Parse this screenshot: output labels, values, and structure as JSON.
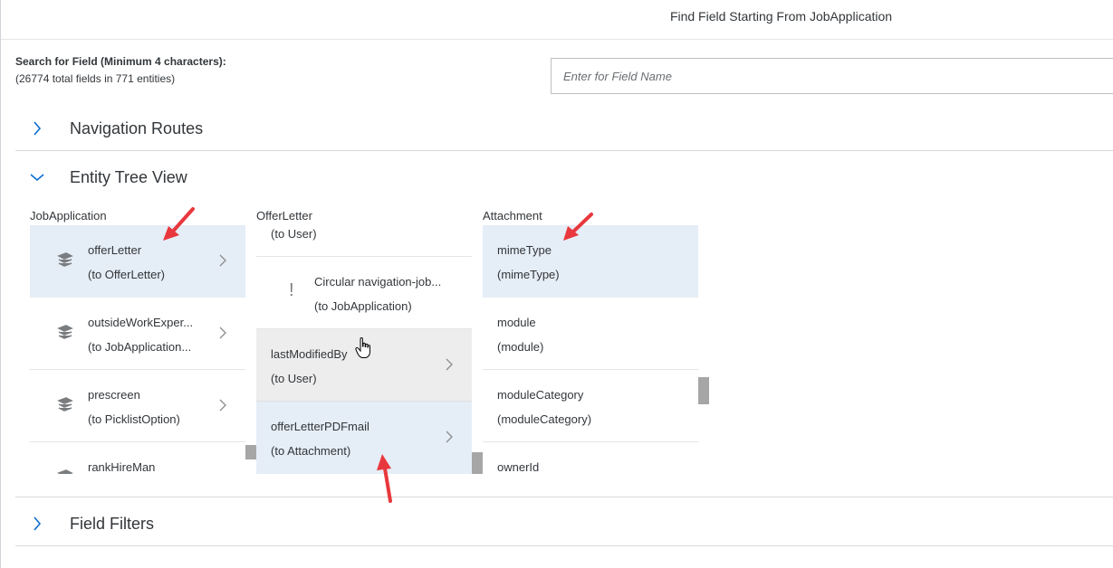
{
  "header": {
    "title": "Find Field Starting From JobApplication"
  },
  "search": {
    "label": "Search for Field (Minimum 4 characters):",
    "count": "(26774 total fields in 771 entities)",
    "placeholder": "Enter for Field Name",
    "value": ""
  },
  "sections": {
    "navigation_routes": {
      "title": "Navigation Routes",
      "expanded": false
    },
    "entity_tree_view": {
      "title": "Entity Tree View",
      "expanded": true
    },
    "field_filters": {
      "title": "Field Filters",
      "expanded": false
    }
  },
  "tree": {
    "columns": [
      {
        "title": "JobApplication",
        "items": [
          {
            "name": "offerLetter",
            "sub": "(to OfferLetter)",
            "icon": "entity-stack-icon",
            "selected": true
          },
          {
            "name": "outsideWorkExper...",
            "sub": "(to JobApplication...",
            "icon": "entity-stack-icon"
          },
          {
            "name": "prescreen",
            "sub": "(to PicklistOption)",
            "icon": "entity-stack-icon"
          },
          {
            "name": "rankHireMan",
            "sub": "",
            "icon": "entity-stack-icon"
          }
        ]
      },
      {
        "title": "OfferLetter",
        "partial_top": "(to User)",
        "items": [
          {
            "name": "Circular navigation-job...",
            "sub": "(to JobApplication)",
            "icon": "warning-icon",
            "glyph": "!"
          },
          {
            "name": "lastModifiedBy",
            "sub": "(to User)",
            "icon": "none",
            "hovered": true
          },
          {
            "name": "offerLetterPDFmail",
            "sub": "(to Attachment)",
            "icon": "none",
            "selected": true
          }
        ]
      },
      {
        "title": "Attachment",
        "items": [
          {
            "name": "mimeType",
            "sub": "(mimeType)",
            "selected": true
          },
          {
            "name": "module",
            "sub": "(module)"
          },
          {
            "name": "moduleCategory",
            "sub": "(moduleCategory)"
          },
          {
            "name": "ownerId",
            "sub": ""
          }
        ]
      }
    ]
  },
  "colors": {
    "selected_bg": "#e5edf6",
    "hover_bg": "#ededed",
    "chevron": "#0a6ed1",
    "annotation_arrow": "#e8383d"
  }
}
